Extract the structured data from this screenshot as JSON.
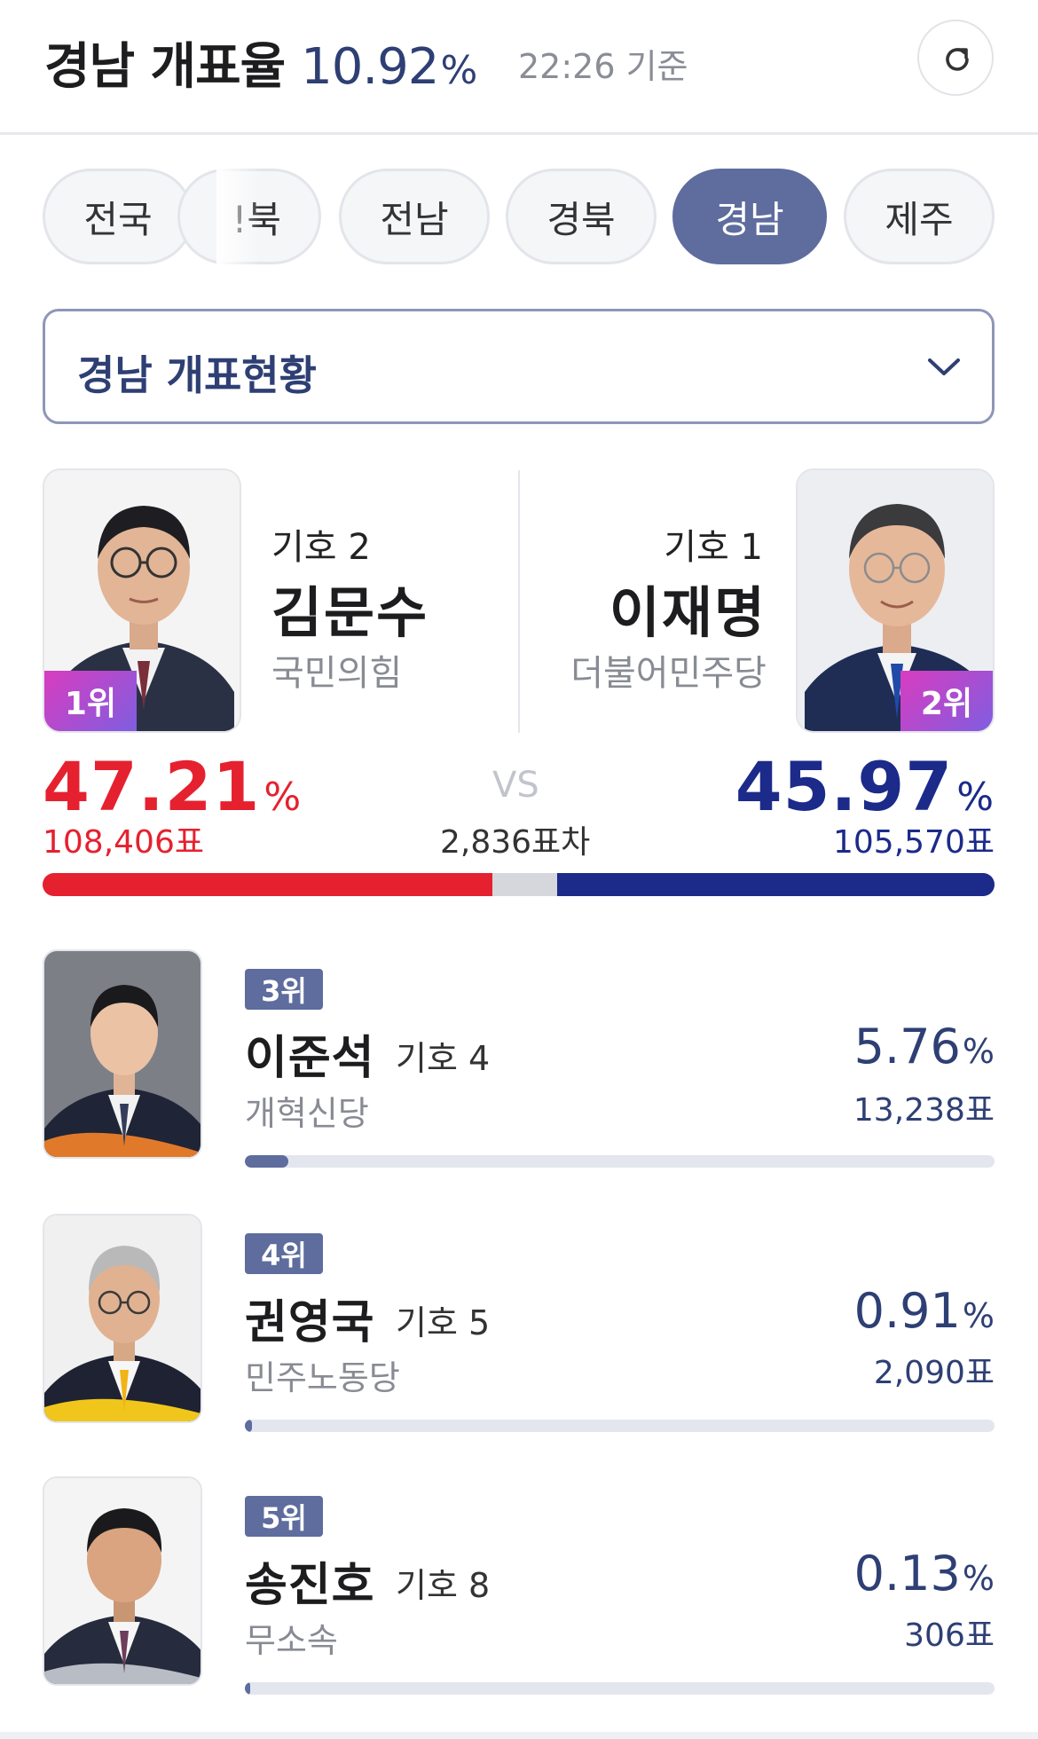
{
  "header": {
    "region": "경남",
    "label": "개표율",
    "rate": "10.92",
    "rate_unit": "%",
    "time": "22:26 기준",
    "refresh_icon": "refresh-icon"
  },
  "tabs": [
    {
      "label": "전국"
    },
    {
      "label": "!북"
    },
    {
      "label": "전남"
    },
    {
      "label": "경북"
    },
    {
      "label": "경남",
      "active": true
    },
    {
      "label": "제주"
    }
  ],
  "select": {
    "label": "경남 개표현황",
    "icon": "chevron-down-icon"
  },
  "top_candidates": {
    "left": {
      "rank": "1위",
      "giho": "기호 2",
      "name": "김문수",
      "party": "국민의힘",
      "percent": "47.21",
      "unit": "%",
      "votes": "108,406표",
      "color": "#e5212f",
      "share": 0.4721
    },
    "right": {
      "rank": "2위",
      "giho": "기호 1",
      "name": "이재명",
      "party": "더불어민주당",
      "percent": "45.97",
      "unit": "%",
      "votes": "105,570표",
      "color": "#1c2a8a",
      "share": 0.4597
    },
    "vs": "VS",
    "gap": "2,836표차"
  },
  "other_candidates": [
    {
      "rank": "3위",
      "name": "이준석",
      "giho": "기호 4",
      "party": "개혁신당",
      "percent": "5.76",
      "unit": "%",
      "votes": "13,238표",
      "share": 0.0576
    },
    {
      "rank": "4위",
      "name": "권영국",
      "giho": "기호 5",
      "party": "민주노동당",
      "percent": "0.91",
      "unit": "%",
      "votes": "2,090표",
      "share": 0.0091
    },
    {
      "rank": "5위",
      "name": "송진호",
      "giho": "기호 8",
      "party": "무소속",
      "percent": "0.13",
      "unit": "%",
      "votes": "306표",
      "share": 0.0013
    }
  ]
}
